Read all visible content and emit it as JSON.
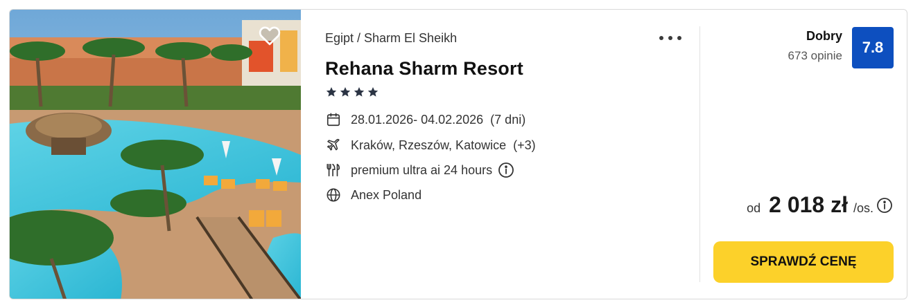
{
  "offer": {
    "breadcrumb": "Egipt / Sharm El Sheikh",
    "hotel_name": "Rehana Sharm Resort",
    "stars": 4,
    "dates": "28.01.2026- 04.02.2026",
    "duration": "(7 dni)",
    "departure": "Kraków, Rzeszów, Katowice",
    "departure_extra": "(+3)",
    "board": "premium ultra ai 24 hours",
    "operator": "Anex Poland"
  },
  "rating": {
    "label": "Dobry",
    "count": "673 opinie",
    "score": "7.8"
  },
  "price": {
    "from_label": "od",
    "amount": "2 018 zł",
    "per_person": "/os."
  },
  "cta": {
    "label": "SPRAWDŹ CENĘ"
  },
  "colors": {
    "badge": "#0d4fbf",
    "cta": "#fcd12a"
  },
  "icons": [
    "heart-icon",
    "more-icon",
    "star-icon",
    "calendar-icon",
    "plane-icon",
    "cutlery-icon",
    "info-icon",
    "globe-icon"
  ]
}
